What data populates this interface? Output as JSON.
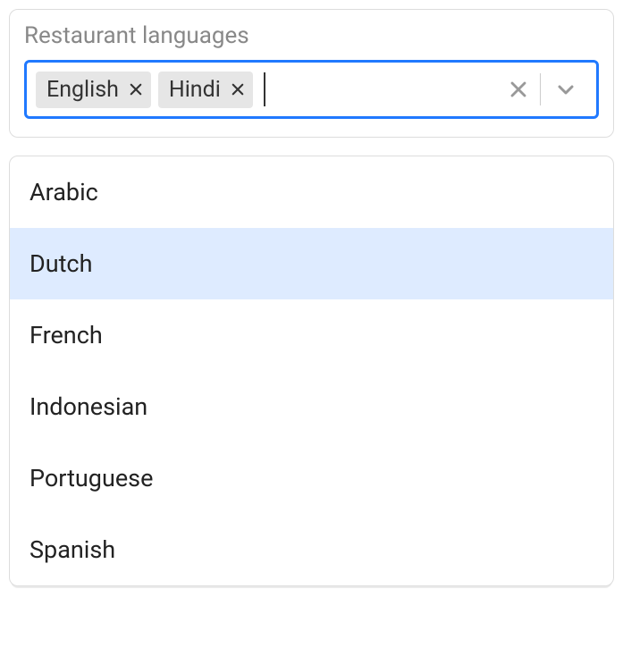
{
  "field": {
    "label": "Restaurant languages"
  },
  "selected": [
    {
      "label": "English"
    },
    {
      "label": "Hindi"
    }
  ],
  "options": [
    {
      "label": "Arabic",
      "highlighted": false
    },
    {
      "label": "Dutch",
      "highlighted": true
    },
    {
      "label": "French",
      "highlighted": false
    },
    {
      "label": "Indonesian",
      "highlighted": false
    },
    {
      "label": "Portuguese",
      "highlighted": false
    },
    {
      "label": "Spanish",
      "highlighted": false
    }
  ]
}
